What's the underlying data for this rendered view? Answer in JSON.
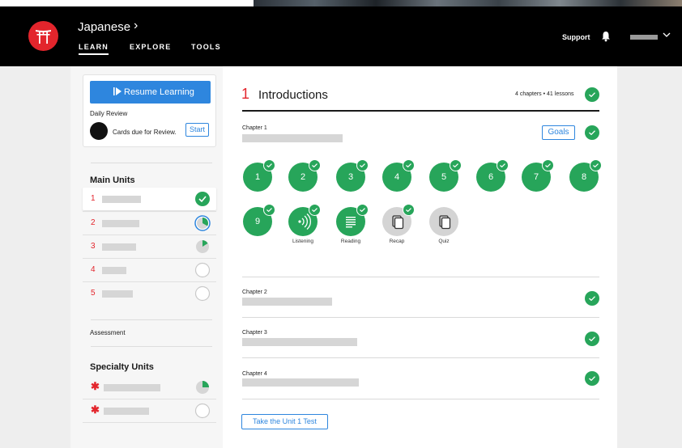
{
  "header": {
    "app_title": "Japanese",
    "nav": {
      "learn": "LEARN",
      "explore": "EXPLORE",
      "tools": "TOOLS"
    },
    "support": "Support"
  },
  "sidebar": {
    "resume_label": "Resume Learning",
    "daily_review_title": "Daily Review",
    "daily_review_text": "Cards due for Review.",
    "start_label": "Start",
    "main_units_title": "Main Units",
    "main_units": [
      {
        "num": "1",
        "status": "complete"
      },
      {
        "num": "2",
        "status": "in-progress"
      },
      {
        "num": "3",
        "status": "partial"
      },
      {
        "num": "4",
        "status": "empty"
      },
      {
        "num": "5",
        "status": "empty"
      }
    ],
    "assessment_label": "Assessment",
    "specialty_title": "Specialty Units",
    "specialty_units": [
      {
        "star": "✱",
        "status": "partial"
      },
      {
        "star": "✱",
        "status": "empty"
      }
    ]
  },
  "main": {
    "unit_number": "1",
    "unit_title": "Introductions",
    "unit_meta": "4 chapters • 41 lessons",
    "chapters": [
      {
        "label": "Chapter 1"
      },
      {
        "label": "Chapter 2"
      },
      {
        "label": "Chapter 3"
      },
      {
        "label": "Chapter 4"
      }
    ],
    "goals_label": "Goals",
    "lessons": [
      "1",
      "2",
      "3",
      "4",
      "5",
      "6",
      "7",
      "8",
      "9"
    ],
    "activities": [
      {
        "label": "Listening",
        "icon": "listening-icon"
      },
      {
        "label": "Reading",
        "icon": "reading-icon"
      },
      {
        "label": "Recap",
        "icon": "recap-icon"
      },
      {
        "label": "Quiz",
        "icon": "quiz-icon"
      }
    ],
    "test_label": "Take the Unit 1 Test"
  },
  "colors": {
    "accent_blue": "#2e86de",
    "brand_red": "#e3252c",
    "complete_green": "#27a55a",
    "header_black": "#000000"
  }
}
